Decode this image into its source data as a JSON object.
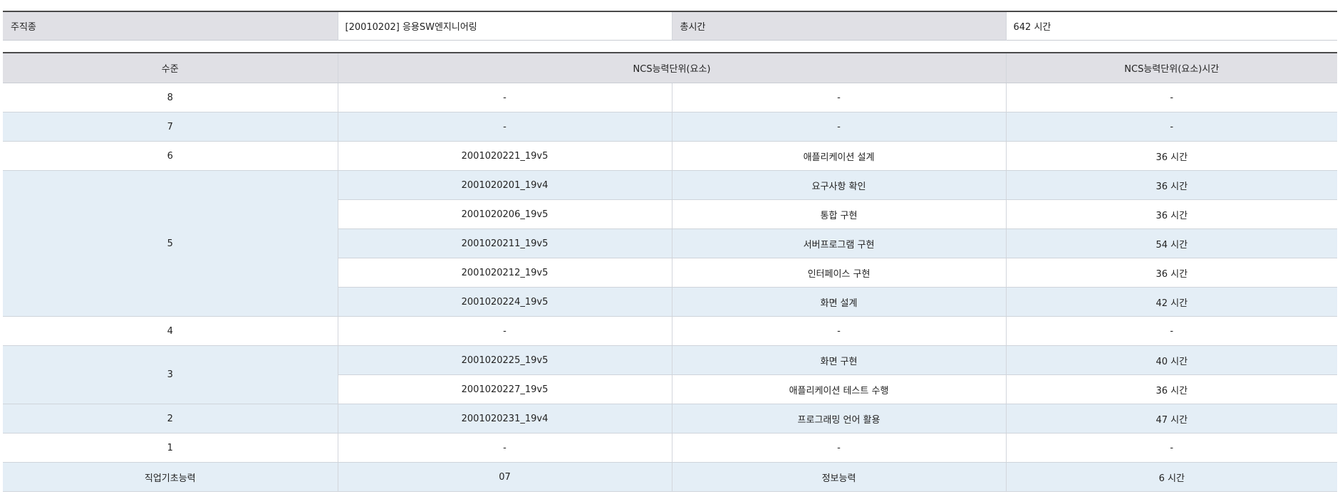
{
  "summary": {
    "job_label": "주직종",
    "job_value": "[20010202] 응용SW엔지니어링",
    "total_label": "총시간",
    "total_value": "642 시간"
  },
  "table": {
    "headers": [
      "수준",
      "NCS능력단위(요소)",
      "NCS능력단위(요소)시간"
    ],
    "levels": [
      {
        "level": "8",
        "band": "odd",
        "units": [
          {
            "code": "-",
            "name": "-",
            "hours": "-"
          }
        ]
      },
      {
        "level": "7",
        "band": "even",
        "units": [
          {
            "code": "-",
            "name": "-",
            "hours": "-"
          }
        ]
      },
      {
        "level": "6",
        "band": "odd",
        "units": [
          {
            "code": "2001020221_19v5",
            "name": "애플리케이션 설계",
            "hours": "36 시간"
          }
        ]
      },
      {
        "level": "5",
        "band": "even",
        "units": [
          {
            "code": "2001020201_19v4",
            "name": "요구사항 확인",
            "hours": "36 시간"
          },
          {
            "code": "2001020206_19v5",
            "name": "통합 구현",
            "hours": "36 시간"
          },
          {
            "code": "2001020211_19v5",
            "name": "서버프로그램 구현",
            "hours": "54 시간"
          },
          {
            "code": "2001020212_19v5",
            "name": "인터페이스 구현",
            "hours": "36 시간"
          },
          {
            "code": "2001020224_19v5",
            "name": "화면 설계",
            "hours": "42 시간"
          }
        ]
      },
      {
        "level": "4",
        "band": "odd",
        "units": [
          {
            "code": "-",
            "name": "-",
            "hours": "-"
          }
        ]
      },
      {
        "level": "3",
        "band": "even",
        "units": [
          {
            "code": "2001020225_19v5",
            "name": "화면 구현",
            "hours": "40 시간"
          },
          {
            "code": "2001020227_19v5",
            "name": "애플리케이션 테스트 수행",
            "hours": "36 시간"
          }
        ]
      },
      {
        "level": "2",
        "band": "even",
        "units": [
          {
            "code": "2001020231_19v4",
            "name": "프로그래밍 언어 활용",
            "hours": "47 시간"
          }
        ]
      },
      {
        "level": "1",
        "band": "odd",
        "units": [
          {
            "code": "-",
            "name": "-",
            "hours": "-"
          }
        ]
      },
      {
        "level": "직업기초능력",
        "band": "even",
        "units": [
          {
            "code": "07",
            "name": "정보능력",
            "hours": "6 시간"
          }
        ]
      }
    ]
  },
  "colors": {
    "header_bg": "#e0e0e5",
    "row_alt_bg": "#e4eef6",
    "row_bg": "#ffffff",
    "top_border": "#4a4a4a"
  }
}
